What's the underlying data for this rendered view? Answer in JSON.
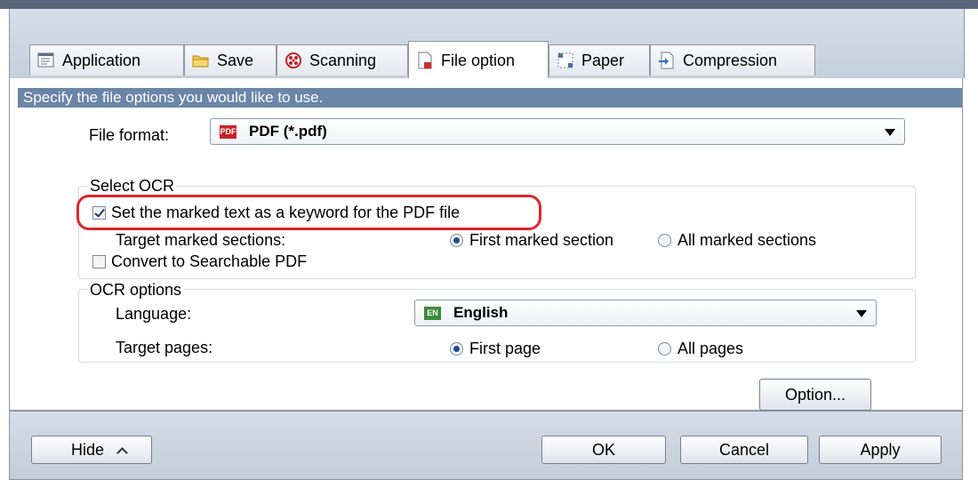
{
  "tabs": [
    {
      "label": "Application",
      "icon": "application-icon"
    },
    {
      "label": "Save",
      "icon": "folder-icon"
    },
    {
      "label": "Scanning",
      "icon": "scanning-icon"
    },
    {
      "label": "File option",
      "icon": "file-option-icon",
      "active": true
    },
    {
      "label": "Paper",
      "icon": "paper-icon"
    },
    {
      "label": "Compression",
      "icon": "compression-icon"
    }
  ],
  "header": {
    "text": "Specify the file options you would like to use."
  },
  "file_format": {
    "label": "File format:",
    "badge": "PDF",
    "value": "PDF (*.pdf)"
  },
  "select_ocr": {
    "title": "Select OCR",
    "keyword_checkbox": {
      "label": "Set the marked text as a keyword for the PDF file",
      "checked": true
    },
    "target_label": "Target marked sections:",
    "radio_first": {
      "label": "First marked section",
      "selected": true
    },
    "radio_all": {
      "label": "All marked sections",
      "selected": false
    },
    "searchable_checkbox": {
      "label": "Convert to Searchable PDF",
      "checked": false
    }
  },
  "ocr_options": {
    "title": "OCR options",
    "language_label": "Language:",
    "language_badge": "EN",
    "language_value": "English",
    "pages_label": "Target pages:",
    "radio_first_page": {
      "label": "First page",
      "selected": true
    },
    "radio_all_pages": {
      "label": "All pages",
      "selected": false
    }
  },
  "option_button": "Option...",
  "footer": {
    "hide": "Hide",
    "ok": "OK",
    "cancel": "Cancel",
    "apply": "Apply"
  },
  "colors": {
    "header_bg": "#6b85a8",
    "highlight": "#e0242b",
    "pdf_badge": "#c8232c",
    "en_badge": "#3d8a3a"
  }
}
